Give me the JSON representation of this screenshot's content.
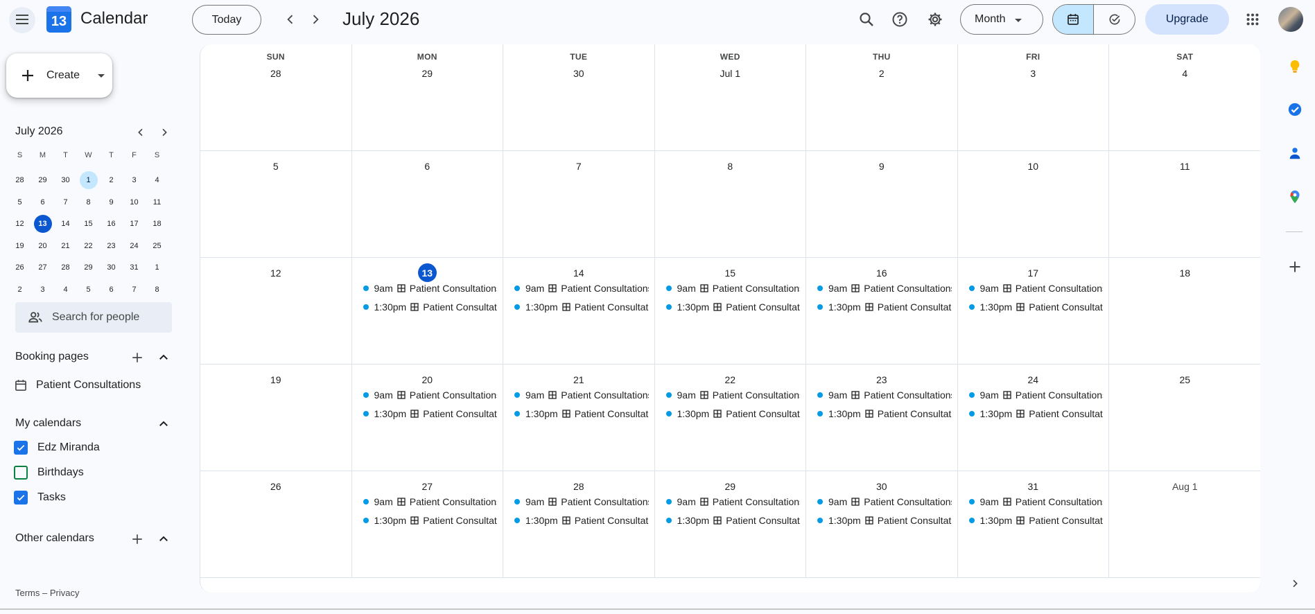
{
  "header": {
    "app_title": "Calendar",
    "logo_day": "13",
    "today_label": "Today",
    "current_period": "July 2026",
    "view_label": "Month",
    "upgrade_label": "Upgrade"
  },
  "sidebar": {
    "create_label": "Create",
    "mini_calendar": {
      "title": "July 2026",
      "weekday_headers": [
        "S",
        "M",
        "T",
        "W",
        "T",
        "F",
        "S"
      ],
      "weeks": [
        [
          "28",
          "29",
          "30",
          "1",
          "2",
          "3",
          "4"
        ],
        [
          "5",
          "6",
          "7",
          "8",
          "9",
          "10",
          "11"
        ],
        [
          "12",
          "13",
          "14",
          "15",
          "16",
          "17",
          "18"
        ],
        [
          "19",
          "20",
          "21",
          "22",
          "23",
          "24",
          "25"
        ],
        [
          "26",
          "27",
          "28",
          "29",
          "30",
          "31",
          "1"
        ],
        [
          "2",
          "3",
          "4",
          "5",
          "6",
          "7",
          "8"
        ]
      ],
      "selected": "1",
      "today": "13"
    },
    "people_search_placeholder": "Search for people",
    "booking_pages": {
      "title": "Booking pages",
      "items": [
        "Patient Consultations"
      ]
    },
    "my_calendars": {
      "title": "My calendars",
      "items": [
        {
          "label": "Edz Miranda",
          "checked": true,
          "color": "#1a73e8"
        },
        {
          "label": "Birthdays",
          "checked": false,
          "color": "#0b8043"
        },
        {
          "label": "Tasks",
          "checked": true,
          "color": "#1a73e8"
        }
      ]
    },
    "other_calendars": {
      "title": "Other calendars"
    },
    "footer": {
      "terms": "Terms",
      "separator": "–",
      "privacy": "Privacy"
    }
  },
  "month": {
    "weekday_headers": [
      "SUN",
      "MON",
      "TUE",
      "WED",
      "THU",
      "FRI",
      "SAT"
    ],
    "event_color": "#039be5",
    "weeks": [
      [
        {
          "date": "28",
          "events": []
        },
        {
          "date": "29",
          "events": []
        },
        {
          "date": "30",
          "events": []
        },
        {
          "date": "Jul 1",
          "events": []
        },
        {
          "date": "2",
          "events": []
        },
        {
          "date": "3",
          "events": []
        },
        {
          "date": "4",
          "events": []
        }
      ],
      [
        {
          "date": "5",
          "events": []
        },
        {
          "date": "6",
          "events": []
        },
        {
          "date": "7",
          "events": []
        },
        {
          "date": "8",
          "events": []
        },
        {
          "date": "9",
          "events": []
        },
        {
          "date": "10",
          "events": []
        },
        {
          "date": "11",
          "events": []
        }
      ],
      [
        {
          "date": "12",
          "events": []
        },
        {
          "date": "13",
          "today": true,
          "events": [
            {
              "time": "9am",
              "title": "Patient Consultations"
            },
            {
              "time": "1:30pm",
              "title": "Patient Consultations"
            }
          ]
        },
        {
          "date": "14",
          "events": [
            {
              "time": "9am",
              "title": "Patient Consultations"
            },
            {
              "time": "1:30pm",
              "title": "Patient Consultations"
            }
          ]
        },
        {
          "date": "15",
          "events": [
            {
              "time": "9am",
              "title": "Patient Consultations"
            },
            {
              "time": "1:30pm",
              "title": "Patient Consultations"
            }
          ]
        },
        {
          "date": "16",
          "events": [
            {
              "time": "9am",
              "title": "Patient Consultations"
            },
            {
              "time": "1:30pm",
              "title": "Patient Consultations"
            }
          ]
        },
        {
          "date": "17",
          "events": [
            {
              "time": "9am",
              "title": "Patient Consultations"
            },
            {
              "time": "1:30pm",
              "title": "Patient Consultations"
            }
          ]
        },
        {
          "date": "18",
          "events": []
        }
      ],
      [
        {
          "date": "19",
          "events": []
        },
        {
          "date": "20",
          "events": [
            {
              "time": "9am",
              "title": "Patient Consultations"
            },
            {
              "time": "1:30pm",
              "title": "Patient Consultations"
            }
          ]
        },
        {
          "date": "21",
          "events": [
            {
              "time": "9am",
              "title": "Patient Consultations"
            },
            {
              "time": "1:30pm",
              "title": "Patient Consultations"
            }
          ]
        },
        {
          "date": "22",
          "events": [
            {
              "time": "9am",
              "title": "Patient Consultations"
            },
            {
              "time": "1:30pm",
              "title": "Patient Consultations"
            }
          ]
        },
        {
          "date": "23",
          "events": [
            {
              "time": "9am",
              "title": "Patient Consultations"
            },
            {
              "time": "1:30pm",
              "title": "Patient Consultations"
            }
          ]
        },
        {
          "date": "24",
          "events": [
            {
              "time": "9am",
              "title": "Patient Consultations"
            },
            {
              "time": "1:30pm",
              "title": "Patient Consultations"
            }
          ]
        },
        {
          "date": "25",
          "events": []
        }
      ],
      [
        {
          "date": "26",
          "events": []
        },
        {
          "date": "27",
          "events": [
            {
              "time": "9am",
              "title": "Patient Consultations"
            },
            {
              "time": "1:30pm",
              "title": "Patient Consultations"
            }
          ]
        },
        {
          "date": "28",
          "events": [
            {
              "time": "9am",
              "title": "Patient Consultations"
            },
            {
              "time": "1:30pm",
              "title": "Patient Consultations"
            }
          ]
        },
        {
          "date": "29",
          "events": [
            {
              "time": "9am",
              "title": "Patient Consultations"
            },
            {
              "time": "1:30pm",
              "title": "Patient Consultations"
            }
          ]
        },
        {
          "date": "30",
          "events": [
            {
              "time": "9am",
              "title": "Patient Consultations"
            },
            {
              "time": "1:30pm",
              "title": "Patient Consultations"
            }
          ]
        },
        {
          "date": "31",
          "events": [
            {
              "time": "9am",
              "title": "Patient Consultations"
            },
            {
              "time": "1:30pm",
              "title": "Patient Consultations"
            }
          ]
        },
        {
          "date": "Aug 1",
          "other_month": true,
          "events": []
        }
      ]
    ]
  },
  "right_rail": {
    "icons": [
      "keep-icon",
      "tasks-icon",
      "contacts-icon",
      "maps-icon",
      "add-addon-icon",
      "expand-panel-icon"
    ]
  }
}
